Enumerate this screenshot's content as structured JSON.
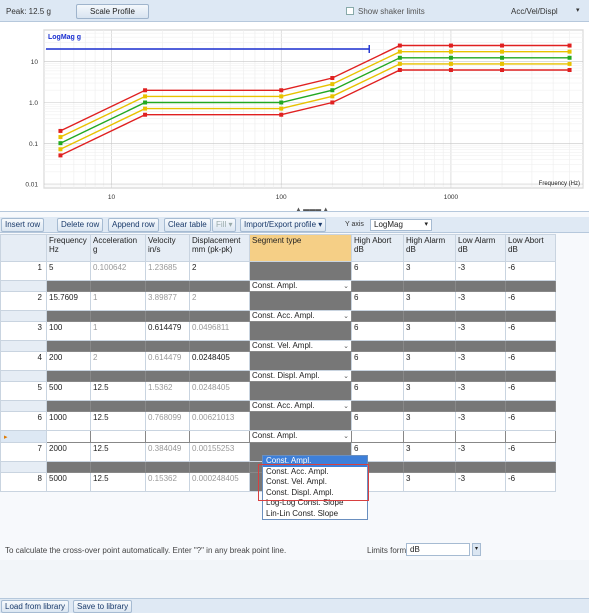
{
  "topbar": {
    "peak_label": "Peak:  12.5 g",
    "scale_profile": "Scale Profile",
    "show_shaker_limits": "Show shaker limits",
    "mode": "Acc/Vel/Displ",
    "mode_arrow": "▾"
  },
  "chart": {
    "title": "LogMag g",
    "x_label": "Frequency (Hz)",
    "y_ticks": [
      "10",
      "1.0",
      "0.1",
      "0.01"
    ],
    "x_ticks": [
      "10",
      "100",
      "1000"
    ],
    "frequencies_hz": [
      5,
      15.7609,
      100,
      200,
      500,
      1000,
      2000,
      5000
    ],
    "reference_g": [
      0.100642,
      1,
      1,
      2,
      12.5,
      12.5,
      12.5,
      12.5
    ],
    "high_alarm_db": 3,
    "low_alarm_db": -3,
    "high_abort_db": 6,
    "low_abort_db": -6,
    "colors": {
      "reference": "#22a822",
      "alarm": "#e8c200",
      "abort": "#e02020",
      "marker_bar": "#1a2fd0"
    }
  },
  "toolbar": {
    "insert_row": "Insert row",
    "delete_row": "Delete row",
    "append_row": "Append row",
    "clear_table": "Clear table",
    "fill": "Fill ▾",
    "import_export": "Import/Export profile ▾",
    "y_axis_label": "Y axis",
    "y_axis_value": "LogMag",
    "y_axis_arrow": "▾"
  },
  "grid": {
    "headers": [
      "Frequency Hz",
      "Acceleration g",
      "Velocity in/s",
      "Displacement mm (pk-pk)",
      "Segment type",
      "High Abort dB",
      "High Alarm dB",
      "Low Alarm dB",
      "Low Abort dB"
    ],
    "rows": [
      {
        "num": "1",
        "freq": "5",
        "acc": "0.100642",
        "vel": "1.23685",
        "disp": "2",
        "ha": "6",
        "hal": "3",
        "la": "-3",
        "lab": "-6"
      },
      {
        "num": "2",
        "freq": "15.7609",
        "acc": "1",
        "vel": "3.89877",
        "disp": "2",
        "ha": "6",
        "hal": "3",
        "la": "-3",
        "lab": "-6"
      },
      {
        "num": "3",
        "freq": "100",
        "acc": "1",
        "vel": "0.614479",
        "disp": "0.0496811",
        "ha": "6",
        "hal": "3",
        "la": "-3",
        "lab": "-6"
      },
      {
        "num": "4",
        "freq": "200",
        "acc": "2",
        "vel": "0.614479",
        "disp": "0.0248405",
        "ha": "6",
        "hal": "3",
        "la": "-3",
        "lab": "-6"
      },
      {
        "num": "5",
        "freq": "500",
        "acc": "12.5",
        "vel": "1.5362",
        "disp": "0.0248405",
        "ha": "6",
        "hal": "3",
        "la": "-3",
        "lab": "-6"
      },
      {
        "num": "6",
        "freq": "1000",
        "acc": "12.5",
        "vel": "0.768099",
        "disp": "0.00621013",
        "ha": "6",
        "hal": "3",
        "la": "-3",
        "lab": "-6"
      },
      {
        "num": "7",
        "freq": "2000",
        "acc": "12.5",
        "vel": "0.384049",
        "disp": "0.00155253",
        "ha": "6",
        "hal": "3",
        "la": "-3",
        "lab": "-6"
      },
      {
        "num": "8",
        "freq": "5000",
        "acc": "12.5",
        "vel": "0.15362",
        "disp": "0.000248405",
        "ha": "6",
        "hal": "3",
        "la": "-3",
        "lab": "-6"
      }
    ],
    "segments": [
      "Const. Ampl.",
      "Const. Acc. Ampl.",
      "Const. Vel. Ampl.",
      "Const. Displ. Ampl.",
      "Const. Acc. Ampl.",
      "Const. Ampl."
    ],
    "cursor_marker": "▸",
    "dropdown_arrow": "⌄"
  },
  "segment_dropdown": {
    "options": [
      "Const. Ampl.",
      "Const. Acc. Ampl.",
      "Const. Vel. Ampl.",
      "Const. Displ. Ampl.",
      "Log-Log Const. Slope",
      "Lin-Lin Const. Slope"
    ],
    "selected": "Const. Ampl."
  },
  "footer": {
    "hint": "To calculate the cross-over point automatically. Enter \"?\" in any break point line.",
    "limits_format_label": "Limits format",
    "limits_format_value": "dB",
    "limits_arrow": "▾",
    "load_library": "Load from library",
    "save_library": "Save to library"
  }
}
